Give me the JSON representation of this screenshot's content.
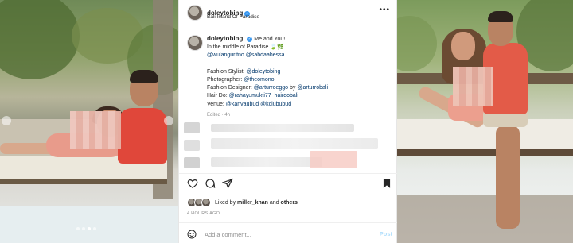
{
  "post": {
    "username": "doleytobing",
    "location": "Bali Island Of Paradise",
    "caption": {
      "line1": "Me and You!",
      "line2": "In the middle of Paradise 🍃🌿",
      "tag1": "@wulanguritno",
      "tag2": "@sabdaahessa",
      "stylist_label": "Fashion Stylist:",
      "stylist": "@doleytobing",
      "photographer_label": "Photographer:",
      "photographer": "@theomono",
      "designer_label": "Fashion Designer:",
      "designer1": "@arturroeggo",
      "designer_by": "by",
      "designer2": "@arturrobali",
      "hair_label": "Hair Do:",
      "hair": "@rahayumukti77_hairdobali",
      "venue_label": "Venue:",
      "venue1": "@kanvaubud",
      "venue2": "@kclububud",
      "edited": "Edited · 4h"
    },
    "likes": {
      "prefix": "Liked by",
      "user": "miller_khan",
      "and": "and",
      "others": "others"
    },
    "timestamp": "4 HOURS AGO",
    "comment_placeholder": "Add a comment...",
    "post_label": "Post",
    "more_label": "•••",
    "verified_mark": "✓"
  },
  "icons": {
    "heart": "heart-icon",
    "comment": "comment-icon",
    "share": "share-icon",
    "bookmark": "bookmark-icon",
    "emoji": "emoji-icon"
  },
  "colors": {
    "link": "#00376b",
    "verified": "#3897f0",
    "post_button": "#b2dffc"
  }
}
